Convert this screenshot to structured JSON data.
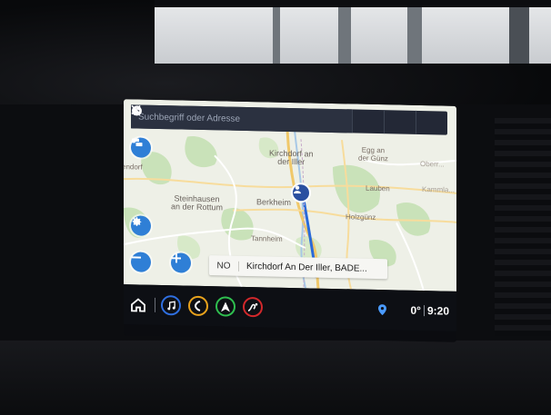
{
  "search": {
    "placeholder": "Suchbegriff oder Adresse",
    "icons": [
      "search-icon",
      "star-icon",
      "clock-icon",
      "close-icon"
    ]
  },
  "map": {
    "labels": [
      {
        "id": "kirchdorf",
        "text": "Kirchdorf an\nder Iller"
      },
      {
        "id": "egg",
        "text": "Egg an\nder Günz"
      },
      {
        "id": "endorf",
        "text": "endorf"
      },
      {
        "id": "oberr",
        "text": "Oberr..."
      },
      {
        "id": "lauben",
        "text": "Lauben"
      },
      {
        "id": "kammlach",
        "text": "Kammla..."
      },
      {
        "id": "steinhausen",
        "text": "Steinhausen\nan der Rottum"
      },
      {
        "id": "berkheim",
        "text": "Berkheim"
      },
      {
        "id": "holzguenz",
        "text": "Holzgünz"
      },
      {
        "id": "tannheim",
        "text": "Tannheim"
      }
    ],
    "destination": {
      "direction": "NO",
      "name": "Kirchdorf An Der Iller, BADE..."
    },
    "controls": [
      "traffic-icon",
      "settings-icon",
      "zoom-out-icon",
      "zoom-in-icon"
    ]
  },
  "statusbar": {
    "apps": [
      {
        "name": "audio",
        "icon": "music-note-icon",
        "color": "#2f6fe0"
      },
      {
        "name": "phone",
        "icon": "phone-icon",
        "color": "#e8a21c"
      },
      {
        "name": "navigation",
        "icon": "navigation-arrow-icon",
        "color": "#2fbf4f"
      },
      {
        "name": "onstar",
        "icon": "onstar-icon",
        "color": "#d3282b"
      }
    ],
    "temperature": "0°",
    "time": "9:20"
  }
}
